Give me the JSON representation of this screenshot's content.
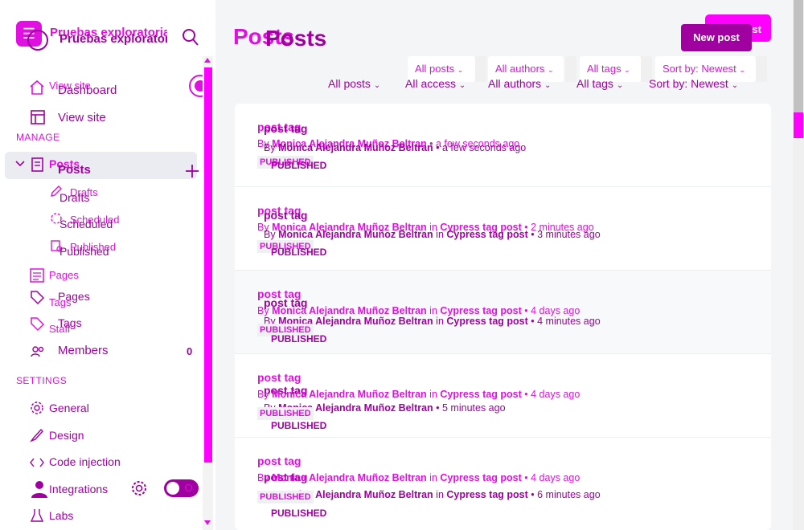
{
  "sidebar": {
    "site_title": "Pruebas exploratorias",
    "site_title_overlay": "Pruebas exploratorias",
    "nav": {
      "dashboard_overlay": "View site",
      "dashboard": "Dashboard",
      "view_site": "View site"
    },
    "manage_label": "MANAGE",
    "posts": {
      "label_overlay": "Posts",
      "label": "Posts"
    },
    "drafts": {
      "label_overlay": "Drafts",
      "label": "Drafts"
    },
    "scheduled": {
      "label_overlay": "Scheduled",
      "label": "Scheduled"
    },
    "published": {
      "label_overlay": "Published",
      "label": "Published"
    },
    "pages": {
      "label_overlay": "Pages",
      "label": "Pages"
    },
    "tags": {
      "label_overlay": "Tags",
      "label": "Tags"
    },
    "staff": {
      "label": "Staff"
    },
    "members": {
      "label": "Members",
      "count": "0"
    },
    "settings_label": "SETTINGS",
    "general": "General",
    "design": "Design",
    "code_injection": "Code injection",
    "integrations": "Integrations",
    "labs": "Labs"
  },
  "header": {
    "title_overlay": "Posts",
    "title": "Posts",
    "new_post_overlay": "New post",
    "new_post": "New post"
  },
  "filters": {
    "top": [
      "All posts",
      "All authors",
      "All tags",
      "Sort by: Newest"
    ],
    "bottom": [
      "All posts",
      "All access",
      "All authors",
      "All tags",
      "Sort by: Newest"
    ]
  },
  "posts": [
    {
      "title_overlay": "post tag",
      "title": "post tag",
      "meta_overlay": {
        "by": "By ",
        "author": "Monica Alejandra Muñoz Beltran",
        "in": "",
        "tag": "",
        "time": " • a few seconds ago"
      },
      "meta": {
        "by": "By ",
        "author": "Monica Alejandra Muñoz Beltran",
        "in": "",
        "tag": "",
        "time": " • a few seconds ago"
      },
      "status_overlay": "PUBLISHED",
      "status": "PUBLISHED"
    },
    {
      "title_overlay": "post tag",
      "title": "post tag",
      "meta_overlay": {
        "by": "By ",
        "author": "Monica Alejandra Muñoz Beltran",
        "in": " in ",
        "tag": "Cypress tag post",
        "time": " • 2 minutes ago"
      },
      "meta": {
        "by": "By ",
        "author": "Monica Alejandra Muñoz Beltran",
        "in": " in ",
        "tag": "Cypress tag post",
        "time": " • 3 minutes ago"
      },
      "status_overlay": "PUBLISHED",
      "status": "PUBLISHED"
    },
    {
      "title_overlay": "post tag",
      "title": "post tag",
      "meta_overlay": {
        "by": "By ",
        "author": "Monica Alejandra Muñoz Beltran",
        "in": " in ",
        "tag": "Cypress tag post",
        "time": " • 4 days ago"
      },
      "meta": {
        "by": "By ",
        "author": "Monica Alejandra Muñoz Beltran",
        "in": " in ",
        "tag": "Cypress tag post",
        "time": " • 4 minutes ago"
      },
      "status_overlay": "PUBLISHED",
      "status": "PUBLISHED"
    },
    {
      "title_overlay": "post tag",
      "title": "post tag",
      "meta_overlay": {
        "by": "By ",
        "author": "Monica Alejandra Muñoz Beltran",
        "in": " in ",
        "tag": "Cypress tag post",
        "time": " • 4 days ago"
      },
      "meta": {
        "by": "By ",
        "author": "Monica Alejandra Muñoz Beltran",
        "in": "",
        "tag": "",
        "time": " • 5 minutes ago"
      },
      "status_overlay": "PUBLISHED",
      "status": "PUBLISHED"
    },
    {
      "title_overlay": "post tag",
      "title": "post tag",
      "meta_overlay": {
        "by": "By ",
        "author": "Monica Alejandra Muñoz Beltran",
        "in": " in ",
        "tag": "Cypress tag post",
        "time": " • 4 days ago"
      },
      "meta": {
        "by": "By ",
        "author": "Monica Alejandra Muñoz Beltran",
        "in": " in ",
        "tag": "Cypress tag post",
        "time": " • 6 minutes ago"
      },
      "status_overlay": "PUBLISHED",
      "status": "PUBLISHED"
    }
  ],
  "colors": {
    "accent": "#a000a0",
    "accent_light": "#e010e0",
    "highlight": "#ff00ff"
  }
}
